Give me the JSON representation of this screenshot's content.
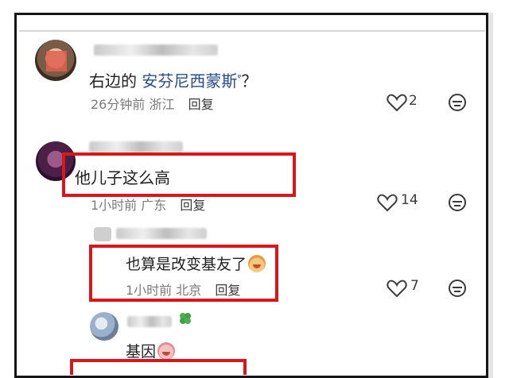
{
  "comments": [
    {
      "text_prefix": "右边的",
      "mention": "安芬尼西蒙斯",
      "text_suffix": "？",
      "time": "26分钟前",
      "location": "浙江",
      "reply_label": "回复",
      "likes": "2"
    },
    {
      "text": "他儿子这么高",
      "time": "1小时前",
      "location": "广东",
      "reply_label": "回复",
      "likes": "14"
    },
    {
      "text": "也算是改变基友了",
      "time": "1小时前",
      "location": "北京",
      "reply_label": "回复",
      "likes": "7"
    },
    {
      "text": "基因"
    }
  ],
  "colors": {
    "highlight_box": "#d8161b",
    "mention": "#2a4b8c",
    "meta": "#7a7a7a"
  },
  "icons": [
    "search-icon",
    "heart-icon",
    "emoji-icon",
    "clover-icon"
  ]
}
